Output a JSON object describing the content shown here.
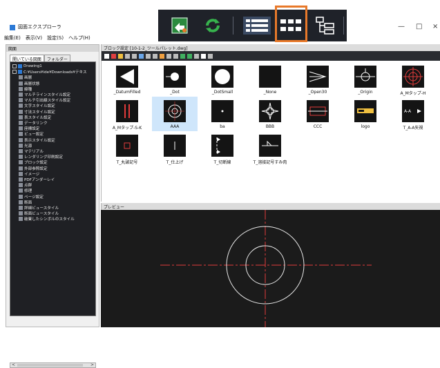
{
  "zoom_toolbar": {
    "buttons": [
      "insert-block-icon",
      "refresh-icon",
      "list-view-icon",
      "large-icon-view-icon",
      "tree-view-icon"
    ],
    "highlighted": "large-icon-view-icon",
    "highlight_color": "#e8792a"
  },
  "window": {
    "title": "図面エクスプローラ",
    "controls": [
      "—",
      "□",
      "×"
    ]
  },
  "menu": [
    "編集(E)",
    "表示(V)",
    "設定(S)",
    "ヘルプ(H)"
  ],
  "left_panel": {
    "header": "図面",
    "tabs": [
      "開いている図面",
      "フォルダー"
    ],
    "tree": [
      {
        "label": "Drawing1",
        "level": 0
      },
      {
        "label": "C:¥Users¥ide¥Downloads¥テキス",
        "level": 0
      },
      {
        "label": "画層",
        "level": 1
      },
      {
        "label": "画層状態",
        "level": 1
      },
      {
        "label": "線種",
        "level": 1
      },
      {
        "label": "マルチラインスタイル設定",
        "level": 1
      },
      {
        "label": "マルチ引出線スタイル設定",
        "level": 1
      },
      {
        "label": "文字スタイル設定",
        "level": 1
      },
      {
        "label": "寸法スタイル設定",
        "level": 1
      },
      {
        "label": "表スタイル設定",
        "level": 1
      },
      {
        "label": "データリンク",
        "level": 1
      },
      {
        "label": "座標設定",
        "level": 1
      },
      {
        "label": "ビュー設定",
        "level": 1
      },
      {
        "label": "表示スタイル設定",
        "level": 1
      },
      {
        "label": "光源",
        "level": 1
      },
      {
        "label": "マテリアル",
        "level": 1
      },
      {
        "label": "レンダリング印刷設定",
        "level": 1
      },
      {
        "label": "ブロック設定",
        "level": 1
      },
      {
        "label": "外部参照設定",
        "level": 1
      },
      {
        "label": "イメージ",
        "level": 1
      },
      {
        "label": "PDFアンダーレイ",
        "level": 1
      },
      {
        "label": "点群",
        "level": 1
      },
      {
        "label": "修理",
        "level": 1
      },
      {
        "label": "ページ設定",
        "level": 1
      },
      {
        "label": "断面",
        "level": 1
      },
      {
        "label": "詳細ビュースタイル",
        "level": 1
      },
      {
        "label": "断面ビュースタイル",
        "level": 1
      },
      {
        "label": "破棄したシンボルのスタイル",
        "level": 1
      }
    ],
    "scroll_left": "<",
    "scroll_right": ">"
  },
  "block_panel": {
    "header": "ブロック設定 [10-1-2_ツールパレット.dwg]",
    "blocks": [
      {
        "name": "_DatumFilled",
        "icon": "filled-triangle"
      },
      {
        "name": "_Dot",
        "icon": "filled-dot"
      },
      {
        "name": "_DotSmall",
        "icon": "filled-large-dot"
      },
      {
        "name": "_None",
        "icon": "blank"
      },
      {
        "name": "_Open30",
        "icon": "open-arrow"
      },
      {
        "name": "_Origin",
        "icon": "origin-circle"
      },
      {
        "name": "A_Mタップ-H",
        "icon": "red-target"
      },
      {
        "name": "A_Mタップ-S-K",
        "icon": "red-bars"
      },
      {
        "name": "AAA",
        "icon": "concentric-circles",
        "selected": true
      },
      {
        "name": "ba",
        "icon": "small-dot"
      },
      {
        "name": "BBB",
        "icon": "star-shape"
      },
      {
        "name": "CCC",
        "icon": "red-rectangle"
      },
      {
        "name": "logo",
        "icon": "logo-bar"
      },
      {
        "name": "T_A-A矢視",
        "icon": "arrow-label"
      },
      {
        "name": "T_丸破記号",
        "icon": "small-red-box"
      },
      {
        "name": "T_仕上げ",
        "icon": "small-vertical-line"
      },
      {
        "name": "T_切断線",
        "icon": "cut-line"
      },
      {
        "name": "T_溶接記号すみ肉",
        "icon": "weld-symbol"
      }
    ]
  },
  "preview": {
    "header": "プレビュー",
    "colors": {
      "crosshair": "#e23b3b",
      "circles": "#e8e8e8"
    }
  }
}
